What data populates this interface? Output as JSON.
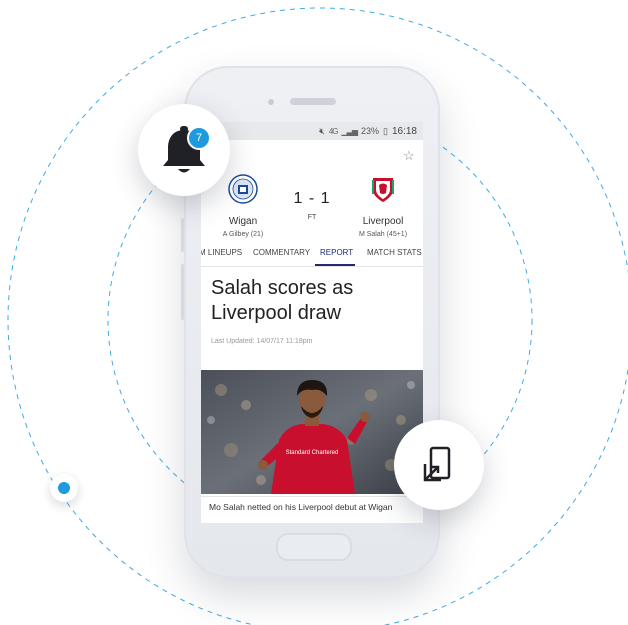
{
  "colors": {
    "accent": "#1e9bde",
    "tab_active": "#1e2a78",
    "ring": "#1e9bde"
  },
  "status_bar": {
    "signal": "4G",
    "battery": "23%",
    "time": "16:18"
  },
  "match": {
    "home": {
      "name": "Wigan",
      "scorer": "A Gilbey (21)",
      "crest_icon": "wigan-crest-icon",
      "crest_text": "WIGAN ATHLETIC"
    },
    "away": {
      "name": "Liverpool",
      "scorer": "M Salah (45+1)",
      "crest_icon": "liverpool-crest-icon"
    },
    "score": "1 - 1",
    "status": "FT"
  },
  "tabs": [
    {
      "label": "M LINEUPS"
    },
    {
      "label": "COMMENTARY"
    },
    {
      "label": "REPORT",
      "active": true
    },
    {
      "label": "MATCH STATS"
    }
  ],
  "article": {
    "headline": "Salah scores as Liverpool draw",
    "updated": "Last Updated: 14/07/17 11:18pm",
    "caption": "Mo Salah netted on his Liverpool debut at Wigan",
    "shirt_text": "Standard Chartered"
  },
  "notifications": {
    "icon": "bell-icon",
    "count": "7"
  },
  "icons": {
    "star": "star-icon",
    "send_to_device": "send-to-device-icon"
  }
}
